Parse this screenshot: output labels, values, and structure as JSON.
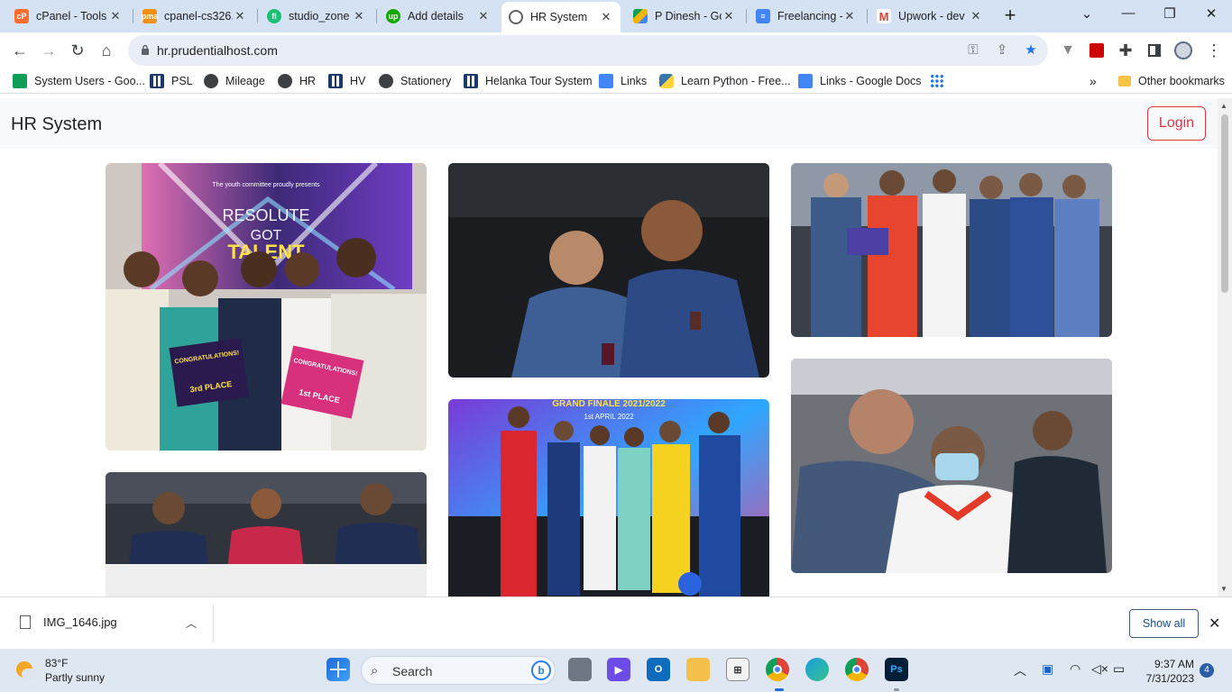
{
  "tabs": [
    {
      "title": "cPanel - Tools",
      "icon": "cpanel-icon"
    },
    {
      "title": "cpanel-cs326.",
      "icon": "phpmyadmin-icon"
    },
    {
      "title": "studio_zone |",
      "icon": "fiverr-icon"
    },
    {
      "title": "Add details",
      "icon": "upwork-icon"
    },
    {
      "title": "HR System",
      "icon": "globe-icon",
      "active": true
    },
    {
      "title": "P Dinesh - Go",
      "icon": "google-drive-icon"
    },
    {
      "title": "Freelancing -",
      "icon": "google-docs-icon"
    },
    {
      "title": "Upwork - dev",
      "icon": "gmail-icon"
    }
  ],
  "address_bar": {
    "url": "hr.prudentialhost.com"
  },
  "bookmarks": [
    {
      "label": "System Users - Goo...",
      "icon": "google-sheets-icon",
      "color": "#0f9d58"
    },
    {
      "label": "PSL",
      "icon": "grid-icon",
      "color": "#1a3a6b"
    },
    {
      "label": "Mileage",
      "icon": "globe-icon",
      "color": "#3c4043"
    },
    {
      "label": "HR",
      "icon": "globe-icon",
      "color": "#3c4043"
    },
    {
      "label": "HV",
      "icon": "grid-icon",
      "color": "#1a3a6b"
    },
    {
      "label": "Stationery",
      "icon": "globe-icon",
      "color": "#3c4043"
    },
    {
      "label": "Helanka Tour System",
      "icon": "grid-icon",
      "color": "#1a3a6b"
    },
    {
      "label": "Links",
      "icon": "google-docs-icon",
      "color": "#4285f4"
    },
    {
      "label": "Learn Python - Free...",
      "icon": "python-icon",
      "color": "#3776ab"
    },
    {
      "label": "Links - Google Docs",
      "icon": "google-docs-icon",
      "color": "#4285f4"
    }
  ],
  "other_bookmarks": "Other bookmarks",
  "page": {
    "brand": "HR System",
    "login_label": "Login"
  },
  "gallery_banner": {
    "line1": "The youth committee proudly presents",
    "line2": "RESOLUTE",
    "line3": "GOT",
    "line4": "TALENT",
    "card1": "CONGRATULATIONS!",
    "card1_place": "3rd PLACE",
    "card2": "CONGRATULATIONS!",
    "card2_place": "1st PLACE",
    "finale_title": "GRAND FINALE 2021/2022",
    "finale_date": "1st APRIL 2022"
  },
  "download": {
    "filename": "IMG_1646.jpg",
    "show_all": "Show all"
  },
  "taskbar": {
    "temperature": "83°F",
    "weather": "Partly sunny",
    "search_label": "Search",
    "time": "9:37 AM",
    "date": "7/31/2023",
    "notifications": "4"
  }
}
